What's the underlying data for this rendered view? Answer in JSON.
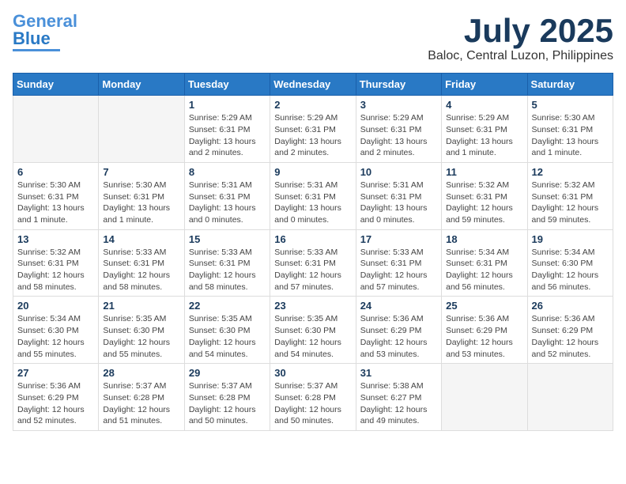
{
  "header": {
    "logo_line1": "General",
    "logo_line2": "Blue",
    "month": "July 2025",
    "location": "Baloc, Central Luzon, Philippines"
  },
  "weekdays": [
    "Sunday",
    "Monday",
    "Tuesday",
    "Wednesday",
    "Thursday",
    "Friday",
    "Saturday"
  ],
  "weeks": [
    [
      {
        "day": "",
        "info": ""
      },
      {
        "day": "",
        "info": ""
      },
      {
        "day": "1",
        "info": "Sunrise: 5:29 AM\nSunset: 6:31 PM\nDaylight: 13 hours and 2 minutes."
      },
      {
        "day": "2",
        "info": "Sunrise: 5:29 AM\nSunset: 6:31 PM\nDaylight: 13 hours and 2 minutes."
      },
      {
        "day": "3",
        "info": "Sunrise: 5:29 AM\nSunset: 6:31 PM\nDaylight: 13 hours and 2 minutes."
      },
      {
        "day": "4",
        "info": "Sunrise: 5:29 AM\nSunset: 6:31 PM\nDaylight: 13 hours and 1 minute."
      },
      {
        "day": "5",
        "info": "Sunrise: 5:30 AM\nSunset: 6:31 PM\nDaylight: 13 hours and 1 minute."
      }
    ],
    [
      {
        "day": "6",
        "info": "Sunrise: 5:30 AM\nSunset: 6:31 PM\nDaylight: 13 hours and 1 minute."
      },
      {
        "day": "7",
        "info": "Sunrise: 5:30 AM\nSunset: 6:31 PM\nDaylight: 13 hours and 1 minute."
      },
      {
        "day": "8",
        "info": "Sunrise: 5:31 AM\nSunset: 6:31 PM\nDaylight: 13 hours and 0 minutes."
      },
      {
        "day": "9",
        "info": "Sunrise: 5:31 AM\nSunset: 6:31 PM\nDaylight: 13 hours and 0 minutes."
      },
      {
        "day": "10",
        "info": "Sunrise: 5:31 AM\nSunset: 6:31 PM\nDaylight: 13 hours and 0 minutes."
      },
      {
        "day": "11",
        "info": "Sunrise: 5:32 AM\nSunset: 6:31 PM\nDaylight: 12 hours and 59 minutes."
      },
      {
        "day": "12",
        "info": "Sunrise: 5:32 AM\nSunset: 6:31 PM\nDaylight: 12 hours and 59 minutes."
      }
    ],
    [
      {
        "day": "13",
        "info": "Sunrise: 5:32 AM\nSunset: 6:31 PM\nDaylight: 12 hours and 58 minutes."
      },
      {
        "day": "14",
        "info": "Sunrise: 5:33 AM\nSunset: 6:31 PM\nDaylight: 12 hours and 58 minutes."
      },
      {
        "day": "15",
        "info": "Sunrise: 5:33 AM\nSunset: 6:31 PM\nDaylight: 12 hours and 58 minutes."
      },
      {
        "day": "16",
        "info": "Sunrise: 5:33 AM\nSunset: 6:31 PM\nDaylight: 12 hours and 57 minutes."
      },
      {
        "day": "17",
        "info": "Sunrise: 5:33 AM\nSunset: 6:31 PM\nDaylight: 12 hours and 57 minutes."
      },
      {
        "day": "18",
        "info": "Sunrise: 5:34 AM\nSunset: 6:31 PM\nDaylight: 12 hours and 56 minutes."
      },
      {
        "day": "19",
        "info": "Sunrise: 5:34 AM\nSunset: 6:30 PM\nDaylight: 12 hours and 56 minutes."
      }
    ],
    [
      {
        "day": "20",
        "info": "Sunrise: 5:34 AM\nSunset: 6:30 PM\nDaylight: 12 hours and 55 minutes."
      },
      {
        "day": "21",
        "info": "Sunrise: 5:35 AM\nSunset: 6:30 PM\nDaylight: 12 hours and 55 minutes."
      },
      {
        "day": "22",
        "info": "Sunrise: 5:35 AM\nSunset: 6:30 PM\nDaylight: 12 hours and 54 minutes."
      },
      {
        "day": "23",
        "info": "Sunrise: 5:35 AM\nSunset: 6:30 PM\nDaylight: 12 hours and 54 minutes."
      },
      {
        "day": "24",
        "info": "Sunrise: 5:36 AM\nSunset: 6:29 PM\nDaylight: 12 hours and 53 minutes."
      },
      {
        "day": "25",
        "info": "Sunrise: 5:36 AM\nSunset: 6:29 PM\nDaylight: 12 hours and 53 minutes."
      },
      {
        "day": "26",
        "info": "Sunrise: 5:36 AM\nSunset: 6:29 PM\nDaylight: 12 hours and 52 minutes."
      }
    ],
    [
      {
        "day": "27",
        "info": "Sunrise: 5:36 AM\nSunset: 6:29 PM\nDaylight: 12 hours and 52 minutes."
      },
      {
        "day": "28",
        "info": "Sunrise: 5:37 AM\nSunset: 6:28 PM\nDaylight: 12 hours and 51 minutes."
      },
      {
        "day": "29",
        "info": "Sunrise: 5:37 AM\nSunset: 6:28 PM\nDaylight: 12 hours and 50 minutes."
      },
      {
        "day": "30",
        "info": "Sunrise: 5:37 AM\nSunset: 6:28 PM\nDaylight: 12 hours and 50 minutes."
      },
      {
        "day": "31",
        "info": "Sunrise: 5:38 AM\nSunset: 6:27 PM\nDaylight: 12 hours and 49 minutes."
      },
      {
        "day": "",
        "info": ""
      },
      {
        "day": "",
        "info": ""
      }
    ]
  ]
}
